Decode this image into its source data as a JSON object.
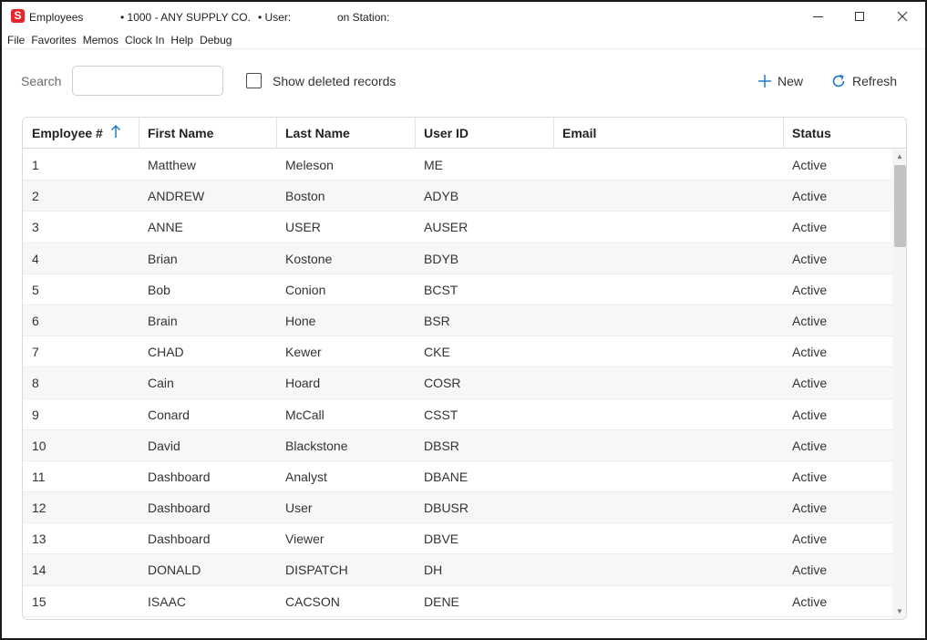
{
  "window": {
    "app_icon": "S",
    "title": "Employees",
    "company": "•  1000 - ANY SUPPLY CO.",
    "user": "•  User:",
    "station": "on Station:",
    "minimize_icon": "minimize-icon",
    "maximize_icon": "maximize-icon",
    "close_icon": "close-icon"
  },
  "menu": {
    "items": [
      "File",
      "Favorites",
      "Memos",
      "Clock In",
      "Help",
      "Debug"
    ]
  },
  "toolbar": {
    "search_label": "Search",
    "search_value": "",
    "show_deleted_label": "Show deleted records",
    "show_deleted_checked": false,
    "new_label": "New",
    "refresh_label": "Refresh",
    "accent_color": "#1f78c8"
  },
  "table": {
    "columns": [
      "Employee #",
      "First Name",
      "Last Name",
      "User ID",
      "Email",
      "Status"
    ],
    "sort_column": "Employee #",
    "sort_direction": "ascending",
    "rows": [
      {
        "id": "1",
        "first": "Matthew",
        "last": "Meleson",
        "user": "ME",
        "email": "",
        "status": "Active"
      },
      {
        "id": "2",
        "first": "ANDREW",
        "last": "Boston",
        "user": "ADYB",
        "email": "",
        "status": "Active"
      },
      {
        "id": "3",
        "first": "ANNE",
        "last": "USER",
        "user": "AUSER",
        "email": "",
        "status": "Active"
      },
      {
        "id": "4",
        "first": "Brian",
        "last": "Kostone",
        "user": "BDYB",
        "email": "",
        "status": "Active"
      },
      {
        "id": "5",
        "first": "Bob",
        "last": "Conion",
        "user": "BCST",
        "email": "",
        "status": "Active"
      },
      {
        "id": "6",
        "first": "Brain",
        "last": "Hone",
        "user": "BSR",
        "email": "",
        "status": "Active"
      },
      {
        "id": "7",
        "first": "CHAD",
        "last": "Kewer",
        "user": "CKE",
        "email": "",
        "status": "Active"
      },
      {
        "id": "8",
        "first": "Cain",
        "last": "Hoard",
        "user": "COSR",
        "email": "",
        "status": "Active"
      },
      {
        "id": "9",
        "first": "Conard",
        "last": "McCall",
        "user": "CSST",
        "email": "",
        "status": "Active"
      },
      {
        "id": "10",
        "first": "David",
        "last": "Blackstone",
        "user": "DBSR",
        "email": "",
        "status": "Active"
      },
      {
        "id": "11",
        "first": "Dashboard",
        "last": "Analyst",
        "user": "DBANE",
        "email": "",
        "status": "Active"
      },
      {
        "id": "12",
        "first": "Dashboard",
        "last": "User",
        "user": "DBUSR",
        "email": "",
        "status": "Active"
      },
      {
        "id": "13",
        "first": "Dashboard",
        "last": "Viewer",
        "user": "DBVE",
        "email": "",
        "status": "Active"
      },
      {
        "id": "14",
        "first": "DONALD",
        "last": "DISPATCH",
        "user": "DH",
        "email": "",
        "status": "Active"
      },
      {
        "id": "15",
        "first": "ISAAC",
        "last": "CACSON",
        "user": "DENE",
        "email": "",
        "status": "Active"
      }
    ]
  }
}
